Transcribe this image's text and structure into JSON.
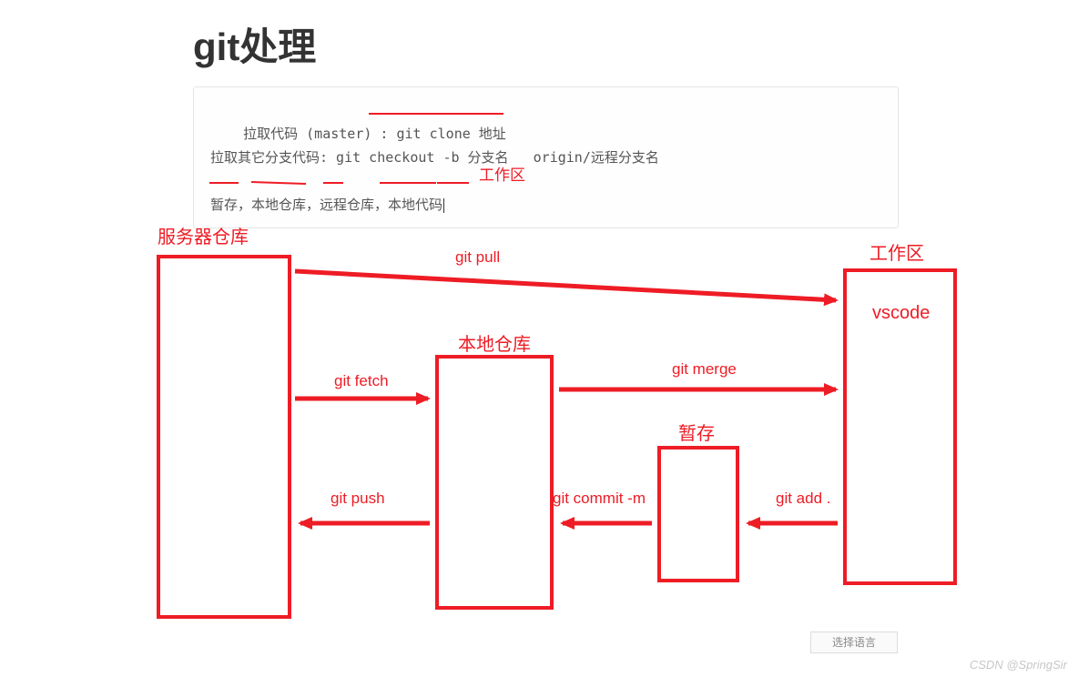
{
  "title": "git处理",
  "code": {
    "line1_label": "拉取代码 (master) :",
    "line1_cmd": "git clone 地址",
    "line2": "拉取其它分支代码: git checkout -b 分支名   origin/远程分支名",
    "line3": "暂存，本地仓库，远程仓库，本地代码"
  },
  "labels": {
    "workspace_inline": "工作区",
    "server_repo": "服务器仓库",
    "workspace": "工作区",
    "local_repo": "本地仓库",
    "stage": "暂存",
    "vscode": "vscode"
  },
  "arrows": {
    "pull": "git pull",
    "fetch": "git fetch",
    "merge": "git merge",
    "push": "git push",
    "commit": "git commit -m",
    "add": "git add ."
  },
  "select_lang": "选择语言",
  "watermark": "CSDN @SpringSir"
}
